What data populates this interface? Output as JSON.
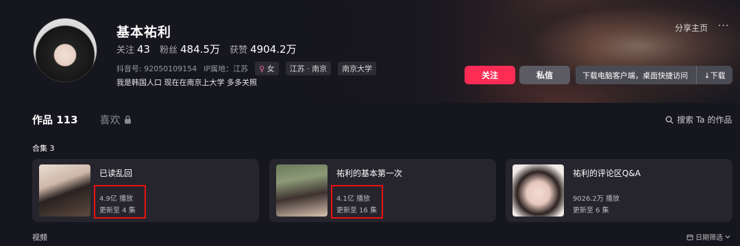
{
  "profile": {
    "name": "基本祐利",
    "follow_label": "关注",
    "follow_count": "43",
    "fans_label": "粉丝",
    "fans_count": "484.5万",
    "likes_label": "获赞",
    "likes_count": "4904.2万",
    "douyin_id": "抖音号: 92050109154",
    "ip": "IP属地：江苏",
    "gender_tag": "女",
    "location_tag": "江苏 · 南京",
    "school_tag": "南京大学",
    "bio": "我是韩国人口  现在在南京上大学  多多关照"
  },
  "header": {
    "share": "分享主页",
    "more": "···",
    "follow_button": "关注",
    "message_button": "私信",
    "download_text": "下载电脑客户端，桌面快捷访问",
    "download_button": "↓下载"
  },
  "tabs": {
    "works": "作品 113",
    "likes": "喜欢"
  },
  "search": "搜索 Ta 的作品",
  "collections": {
    "label": "合集 3",
    "items": [
      {
        "title": "已读乱回",
        "plays": "4.9亿 播放",
        "updated": "更新至 4 集"
      },
      {
        "title": "祐利的基本第一次",
        "plays": "4.1亿 播放",
        "updated": "更新至 16 集"
      },
      {
        "title": "祐利的评论区Q&A",
        "plays": "9026.2万 播放",
        "updated": "更新至 6 集"
      }
    ]
  },
  "videos_label": "视频",
  "date_filter": "日期筛选",
  "colors": {
    "accent": "#fe2c55",
    "highlight": "#e11111"
  }
}
